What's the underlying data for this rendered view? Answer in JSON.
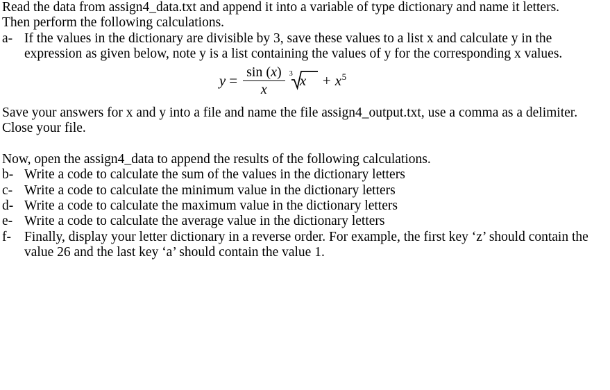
{
  "document": {
    "intro": [
      "Read the data from assign4_data.txt and append it into a variable of type dictionary and name it letters.",
      "Then perform the following calculations."
    ],
    "first_list": [
      {
        "marker": "a-",
        "text": "If the values in the dictionary are divisible by 3, save these values to a list x and calculate y in the expression as given below, note y is a list containing the values of y for the corresponding x values."
      }
    ],
    "formula": {
      "lhs": "y",
      "equals": "=",
      "numerator_function": "sin",
      "numerator_open_paren": "(",
      "numerator_variable": "x",
      "numerator_close_paren": ")",
      "denominator": "x",
      "radical_index": "3",
      "radical_radicand": "x",
      "operator": "+",
      "term_base": "x",
      "term_exponent": "5",
      "plain_text": "y = sin (x) / x * cuberoot(x) + x^5"
    },
    "middle": [
      "Save your answers for x and y into a file and name the file assign4_output.txt, use a comma as a delimiter.",
      "Close your file."
    ],
    "second_intro": "Now, open the assign4_data to append the results of the following calculations.",
    "second_list": [
      {
        "marker": "b-",
        "text": "Write a code to calculate the sum of the values in the dictionary letters"
      },
      {
        "marker": "c-",
        "text": "Write a code to calculate the minimum value in the dictionary letters"
      },
      {
        "marker": "d-",
        "text": "Write a code to calculate the maximum value in the dictionary letters"
      },
      {
        "marker": "e-",
        "text": "Write a code to calculate the average value in the dictionary letters"
      },
      {
        "marker": "f-",
        "text": "Finally, display your letter dictionary in a reverse order.  For example, the first key ‘z’ should contain the value 26 and the last key ‘a’ should contain the value 1."
      }
    ]
  }
}
